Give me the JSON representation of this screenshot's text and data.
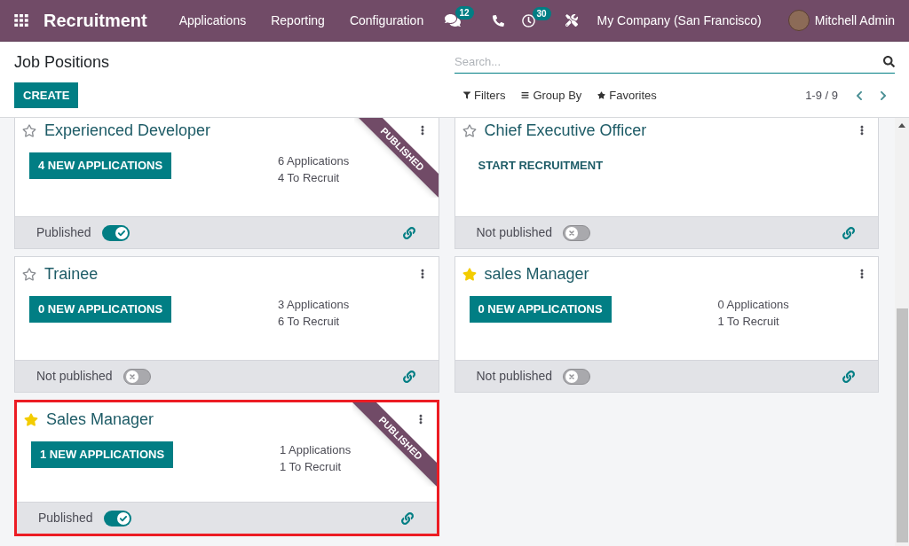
{
  "navbar": {
    "app_name": "Recruitment",
    "menu": [
      "Applications",
      "Reporting",
      "Configuration"
    ],
    "messages_badge": "12",
    "activities_badge": "30",
    "company": "My Company (San Francisco)",
    "user": "Mitchell Admin"
  },
  "control_panel": {
    "title": "Job Positions",
    "search": {
      "placeholder": "Search..."
    },
    "create_button": "CREATE",
    "search_options": [
      {
        "kind": "filter",
        "label": "Filters"
      },
      {
        "kind": "group",
        "label": "Group By"
      },
      {
        "kind": "favorite",
        "label": "Favorites"
      }
    ],
    "pager": "1-9 / 9"
  },
  "cards": [
    {
      "title": "Experienced Developer",
      "favorite": false,
      "action": {
        "kind": "button",
        "label": "4 NEW APPLICATIONS"
      },
      "stats": [
        "6 Applications",
        "4 To Recruit"
      ],
      "ribbon": "PUBLISHED",
      "published": true,
      "status": "Published",
      "highlighted": false
    },
    {
      "title": "Chief Executive Officer",
      "favorite": false,
      "action": {
        "kind": "link",
        "label": "START RECRUITMENT"
      },
      "published": false,
      "status": "Not published",
      "highlighted": false
    },
    {
      "title": "Trainee",
      "favorite": false,
      "action": {
        "kind": "button",
        "label": "0 NEW APPLICATIONS"
      },
      "stats": [
        "3 Applications",
        "6 To Recruit"
      ],
      "published": false,
      "status": "Not published",
      "highlighted": false
    },
    {
      "title": "sales Manager",
      "favorite": true,
      "action": {
        "kind": "button",
        "label": "0 NEW APPLICATIONS"
      },
      "stats": [
        "0 Applications",
        "1 To Recruit"
      ],
      "published": false,
      "status": "Not published",
      "highlighted": false
    },
    {
      "title": "Sales Manager",
      "favorite": true,
      "action": {
        "kind": "button",
        "label": "1 NEW APPLICATIONS"
      },
      "stats": [
        "1 Applications",
        "1 To Recruit"
      ],
      "ribbon": "PUBLISHED",
      "published": true,
      "status": "Published",
      "highlighted": true
    }
  ]
}
